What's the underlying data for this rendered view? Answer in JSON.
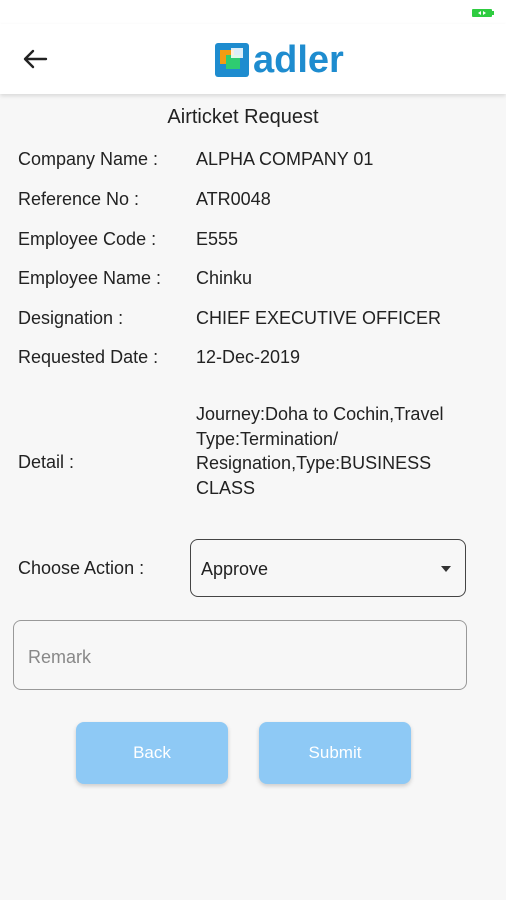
{
  "header": {
    "logo_text": "adler",
    "back_icon": "back-arrow-icon"
  },
  "page_title": "Airticket Request",
  "fields": [
    {
      "label": "Company Name  :",
      "value": "ALPHA COMPANY 01"
    },
    {
      "label": "Reference No  :",
      "value": "ATR0048"
    },
    {
      "label": "Employee Code  :",
      "value": "E555"
    },
    {
      "label": "Employee Name  :",
      "value": "Chinku"
    },
    {
      "label": "Designation  :",
      "value": "CHIEF EXECUTIVE OFFICER"
    },
    {
      "label": "Requested Date  :",
      "value": "12-Dec-2019"
    }
  ],
  "detail": {
    "label": "Detail  :",
    "value": "Journey:Doha to Cochin,Travel Type:Termination/ Resignation,Type:BUSINESS CLASS"
  },
  "action": {
    "label": "Choose Action  :",
    "selected": "Approve"
  },
  "remark": {
    "placeholder": "Remark",
    "value": ""
  },
  "buttons": {
    "back": "Back",
    "submit": "Submit"
  },
  "colors": {
    "brand": "#1e8ccf",
    "button": "#8ec9f5",
    "battery": "#2ecc40"
  }
}
